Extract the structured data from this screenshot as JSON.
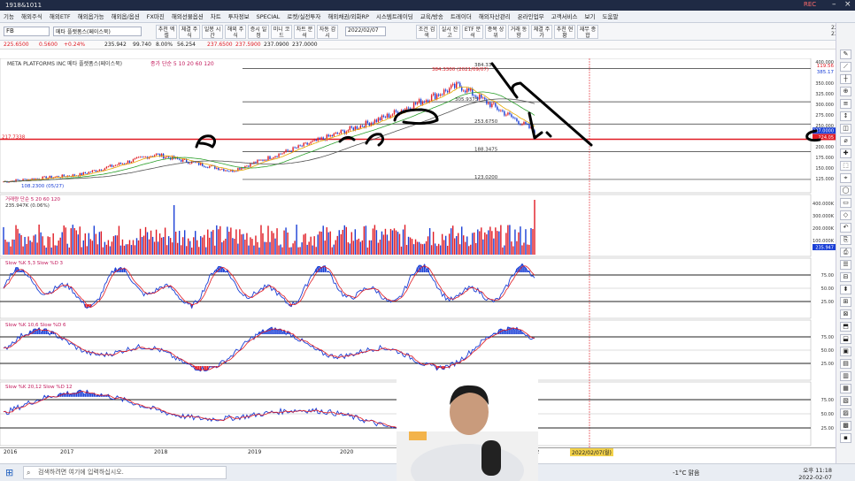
{
  "window": {
    "title": "1918&1011",
    "rec_label": "REC"
  },
  "menu": [
    "기능",
    "해외주식",
    "해외ETF",
    "해외옵가능",
    "해외옵/옵션",
    "FX마진",
    "해외선물옵션",
    "차트",
    "투자정보",
    "SPECIAL",
    "로켓/실전투자",
    "해외채권/외화RP",
    "시스템트레이딩",
    "교육/방송",
    "트레이더",
    "해외자산관리",
    "온라인업무",
    "고객서비스",
    "보기",
    "도움말"
  ],
  "toolbar": {
    "symbol_code": "FB",
    "search_label": "메타 플랫폼스(페이스북)",
    "buttons": [
      "추천 엑셀",
      "체결 주식",
      "일봉 시간",
      "해외 주식",
      "증시 일정",
      "미니 코드",
      "차트 분석",
      "자동 감시",
      "조건 검색",
      "실시 잔고",
      "ETF 분석",
      "종목 상위",
      "거래 동향",
      "체결 주가",
      "추천 현황",
      "재무 종합"
    ],
    "date_value": "2022/02/07"
  },
  "quote": {
    "price": "225.6500",
    "change": "0.5600",
    "change_pct": "+0.24%",
    "prev": "235.942",
    "volume": "99.740",
    "volume_pct": "8.00%",
    "amount": "56.254",
    "open": "237.6500",
    "high": "237.5900",
    "low": "237.0900",
    "close": "237.0000"
  },
  "clock": {
    "date": "22/02/07",
    "time": "23:16:30"
  },
  "chart_data": {
    "type": "line",
    "title": "META PLATFORMS INC 메타 플랫폼스(페이스북)",
    "ma_legend": "종가 단순 5 10 20 60 120",
    "x": [
      "2016",
      "2017",
      "2018",
      "2019",
      "2020",
      "2021",
      "2022"
    ],
    "price_series": [
      {
        "name": "close",
        "values": [
          118,
          134,
          182,
          143,
          206,
          268,
          345,
          237
        ]
      }
    ],
    "price_axis_ticks": [
      "400.000",
      "350.000",
      "325.000",
      "300.000",
      "275.000",
      "250.000",
      "225.000",
      "200.000",
      "175.000",
      "150.000",
      "125.000"
    ],
    "price_labels": {
      "high": "384.3300 (2021/09/07)",
      "high_short": "384.33",
      "low": "108.2300 (05/27)",
      "level_1": "253.6750",
      "level_2": "188.3475",
      "level_3": "123.0200",
      "level_4": "305.9375",
      "left_marker": "217.7338",
      "right_marker_1": "119.56",
      "right_marker_2": "385.17",
      "right_marker_3": "237.0000",
      "right_marker_4": "224.05"
    },
    "volume_panel": {
      "label": "거래량 단순 5 20 60 120",
      "value": "235.947K (0.06%)",
      "ticks": [
        "400.000K",
        "300.000K",
        "200.000K",
        "100.000K"
      ],
      "last": "235.947"
    },
    "stoch_panels": [
      {
        "label": "Slow %K 5,3  Slow %D 3",
        "ticks": [
          "75.00",
          "50.00",
          "25.00"
        ]
      },
      {
        "label": "Slow %K 10,6  Slow %D 6",
        "ticks": [
          "75.00",
          "50.00",
          "25.00"
        ]
      },
      {
        "label": "Slow %K 20,12  Slow %D 12",
        "ticks": [
          "75.00",
          "50.00",
          "25.00"
        ]
      }
    ],
    "date_axis_labels": [
      "2016",
      "2017",
      "2018",
      "2019",
      "2020",
      "2021",
      "2022"
    ],
    "cursor_date": "2022/02/07(월)"
  },
  "taskbar": {
    "search_placeholder": "검색하려면 여기에 입력하십시오.",
    "weather": "-1°C 맑음",
    "time": "오후 11:18",
    "date": "2022-02-07"
  },
  "colors": {
    "accent_red": "#e01b24",
    "blue": "#1a3fd6",
    "navy": "#1f2a44"
  }
}
